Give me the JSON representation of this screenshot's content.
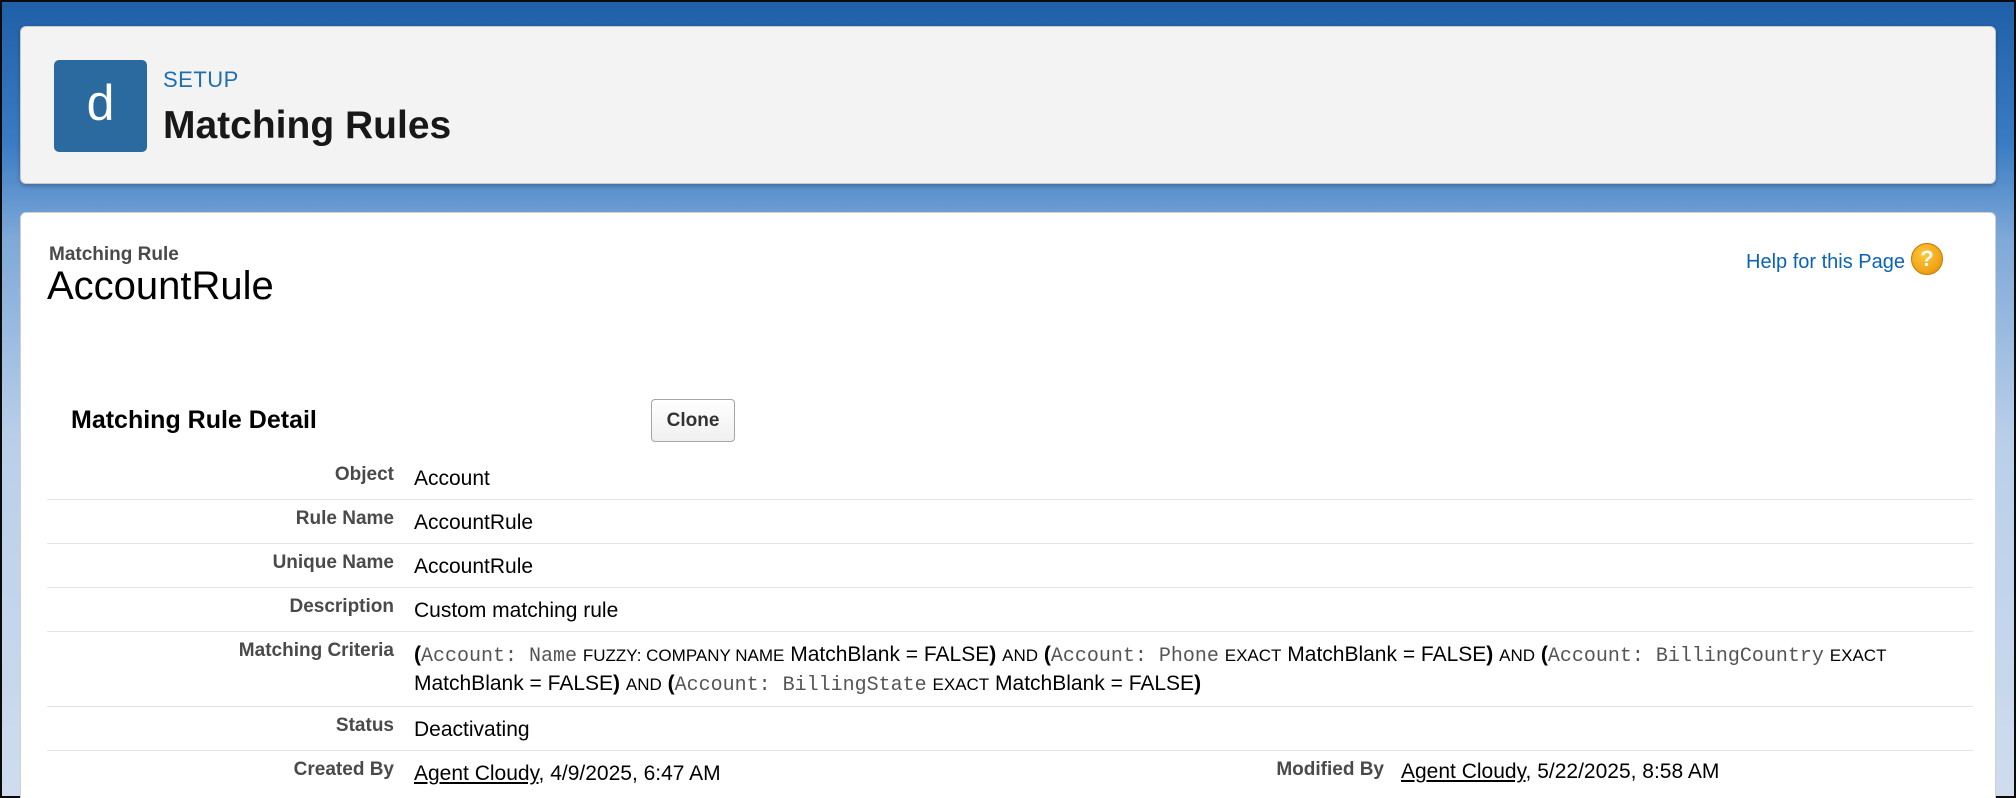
{
  "header": {
    "icon_letter": "d",
    "breadcrumb": "SETUP",
    "title": "Matching Rules"
  },
  "page": {
    "label": "Matching Rule",
    "name": "AccountRule",
    "help_link": "Help for this Page",
    "help_icon": "question-mark-icon"
  },
  "detail": {
    "section_title": "Matching Rule Detail",
    "clone_label": "Clone",
    "rows": {
      "object": {
        "label": "Object",
        "value": "Account"
      },
      "rule_name": {
        "label": "Rule Name",
        "value": "AccountRule"
      },
      "unique_name": {
        "label": "Unique Name",
        "value": "AccountRule"
      },
      "description": {
        "label": "Description",
        "value": "Custom matching rule"
      },
      "criteria": {
        "label": "Matching Criteria",
        "parts": {
          "p1_open": "(",
          "p1_field": "Account: Name",
          "p1_method": "FUZZY: COMPANY NAME",
          "p1_blank": "MatchBlank = FALSE",
          "p1_close": ")",
          "and1": "AND",
          "p2_open": "(",
          "p2_field": "Account: Phone",
          "p2_method": "EXACT",
          "p2_blank": "MatchBlank = FALSE",
          "p2_close": ")",
          "and2": "AND",
          "p3_open": "(",
          "p3_field": "Account: BillingCountry",
          "p3_method": "EXACT",
          "p3_blank": "MatchBlank = FALSE",
          "p3_close": ")",
          "and3": "AND",
          "p4_open": "(",
          "p4_field": "Account: BillingState",
          "p4_method": "EXACT",
          "p4_blank": "MatchBlank = FALSE",
          "p4_close": ")"
        }
      },
      "status": {
        "label": "Status",
        "value": "Deactivating"
      },
      "created": {
        "label": "Created By",
        "user": "Agent Cloudy",
        "date": ", 4/9/2025, 6:47 AM"
      },
      "modified": {
        "label": "Modified By",
        "user": "Agent Cloudy",
        "date": ", 5/22/2025, 8:58 AM"
      }
    }
  },
  "colors": {
    "header_icon_bg": "#2a6a9e",
    "breadcrumb": "#1f6fae",
    "link": "#0b63b5",
    "help_icon": "#f2a61a"
  }
}
